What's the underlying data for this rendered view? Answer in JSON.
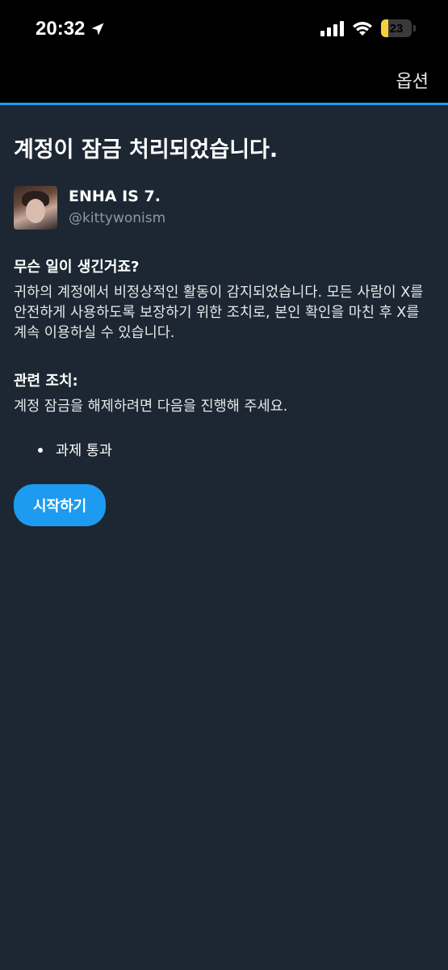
{
  "status_bar": {
    "time": "20:32",
    "battery_level": "23",
    "icons": [
      "location-arrow-icon",
      "cellular-signal-icon",
      "wifi-icon",
      "battery-icon"
    ]
  },
  "header": {
    "options_label": "옵션",
    "accent_color": "#1d9bf0"
  },
  "main": {
    "title": "계정이 잠금 처리되었습니다.",
    "account": {
      "display_name": "ENHA IS 7.",
      "handle": "@kittywonism"
    },
    "what_happened": {
      "heading": "무슨 일이 생긴거죠?",
      "body": "귀하의 계정에서 비정상적인 활동이 감지되었습니다. 모든 사람이 X를 안전하게 사용하도록 보장하기 위한 조치로, 본인 확인을 마친 후 X를 계속 이용하실 수 있습니다."
    },
    "actions": {
      "heading": "관련 조치:",
      "body": "계정 잠금을 해제하려면 다음을 진행해 주세요.",
      "items": [
        "과제 통과"
      ]
    },
    "start_button_label": "시작하기"
  }
}
